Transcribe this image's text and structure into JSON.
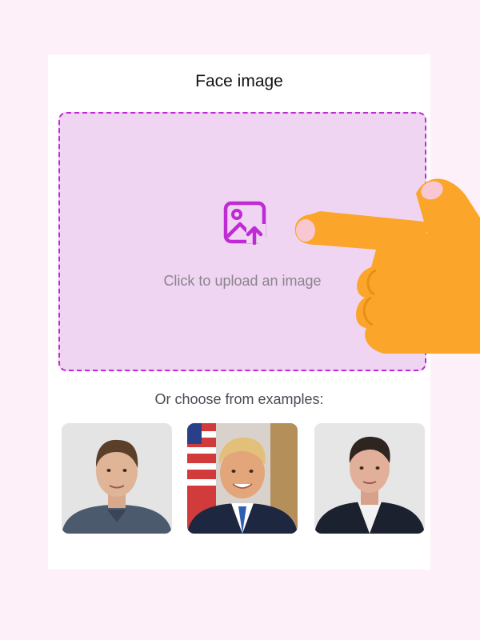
{
  "card": {
    "title": "Face image",
    "dropzone": {
      "icon": "image-upload-icon",
      "text": "Click to upload an image"
    },
    "examples_label": "Or choose from examples:",
    "examples": [
      {
        "icon": "person-photo"
      },
      {
        "icon": "person-photo"
      },
      {
        "icon": "person-photo"
      }
    ]
  },
  "overlay": {
    "icon": "pointing-hand-icon"
  },
  "colors": {
    "background": "#fdf0f8",
    "accent": "#c02ad6",
    "dropzone_fill": "#efd5f2",
    "hand": "#fba52a"
  }
}
